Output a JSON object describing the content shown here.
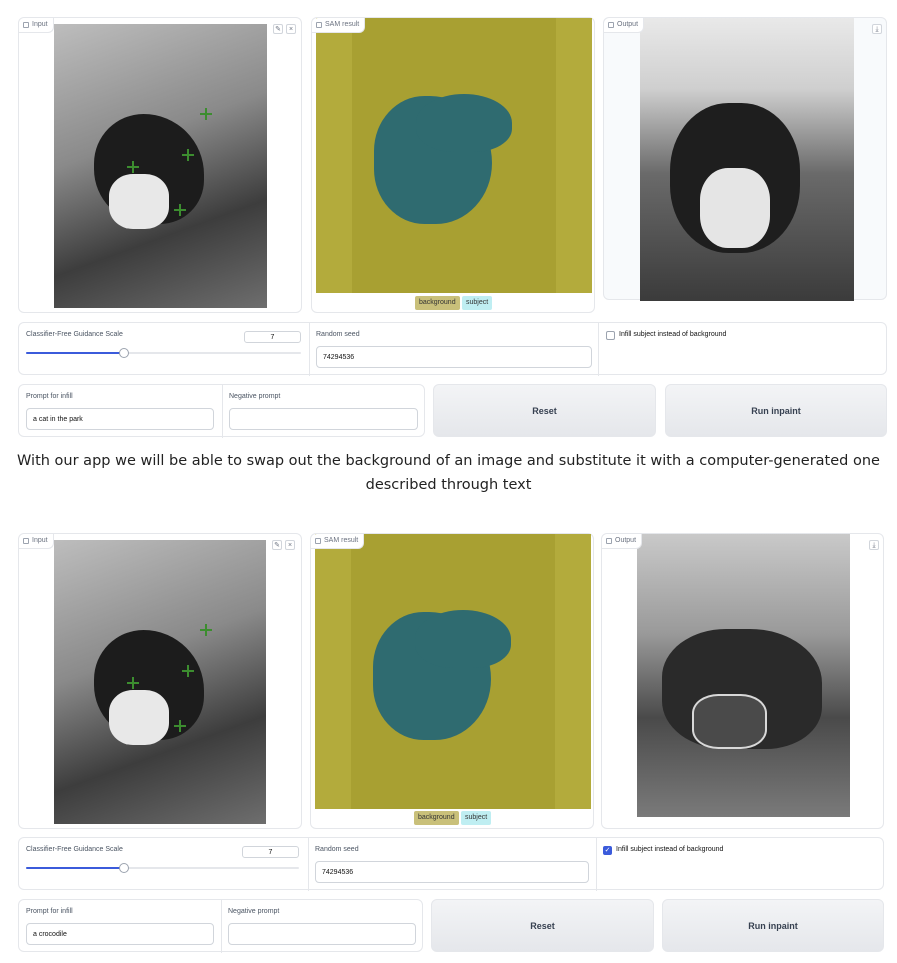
{
  "caption": "With our app we will be able to swap out the background of an image and substitute it with a computer-generated one described through text",
  "examples": [
    {
      "input_label": "Input",
      "sam_label": "SAM result",
      "output_label": "Output",
      "legend": [
        "background",
        "subject"
      ],
      "cfg_label": "Classifier-Free Guidance Scale",
      "cfg_value": "7",
      "cfg_fraction": 0.36,
      "seed_label": "Random seed",
      "seed_value": "74294536",
      "infill_label": "Infill subject instead of background",
      "infill_checked": false,
      "prompt_label": "Prompt for infill",
      "prompt_value": "a cat in the park",
      "neg_label": "Negative prompt",
      "neg_value": "",
      "reset_label": "Reset",
      "run_label": "Run inpaint"
    },
    {
      "input_label": "Input",
      "sam_label": "SAM result",
      "output_label": "Output",
      "legend": [
        "background",
        "subject"
      ],
      "cfg_label": "Classifier-Free Guidance Scale",
      "cfg_value": "7",
      "cfg_fraction": 0.36,
      "seed_label": "Random seed",
      "seed_value": "74294536",
      "infill_label": "Infill subject instead of background",
      "infill_checked": true,
      "prompt_label": "Prompt for infill",
      "prompt_value": "a crocodile",
      "neg_label": "Negative prompt",
      "neg_value": "",
      "reset_label": "Reset",
      "run_label": "Run inpaint"
    }
  ],
  "colors": {
    "mask_background": "#a8a032",
    "mask_subject": "#2f6b70",
    "legend_background": "#c9c07a",
    "legend_subject": "#bfeef2",
    "accent": "#3b5bdb"
  },
  "icons": [
    "image-icon",
    "edit-icon",
    "close-icon",
    "download-icon"
  ]
}
